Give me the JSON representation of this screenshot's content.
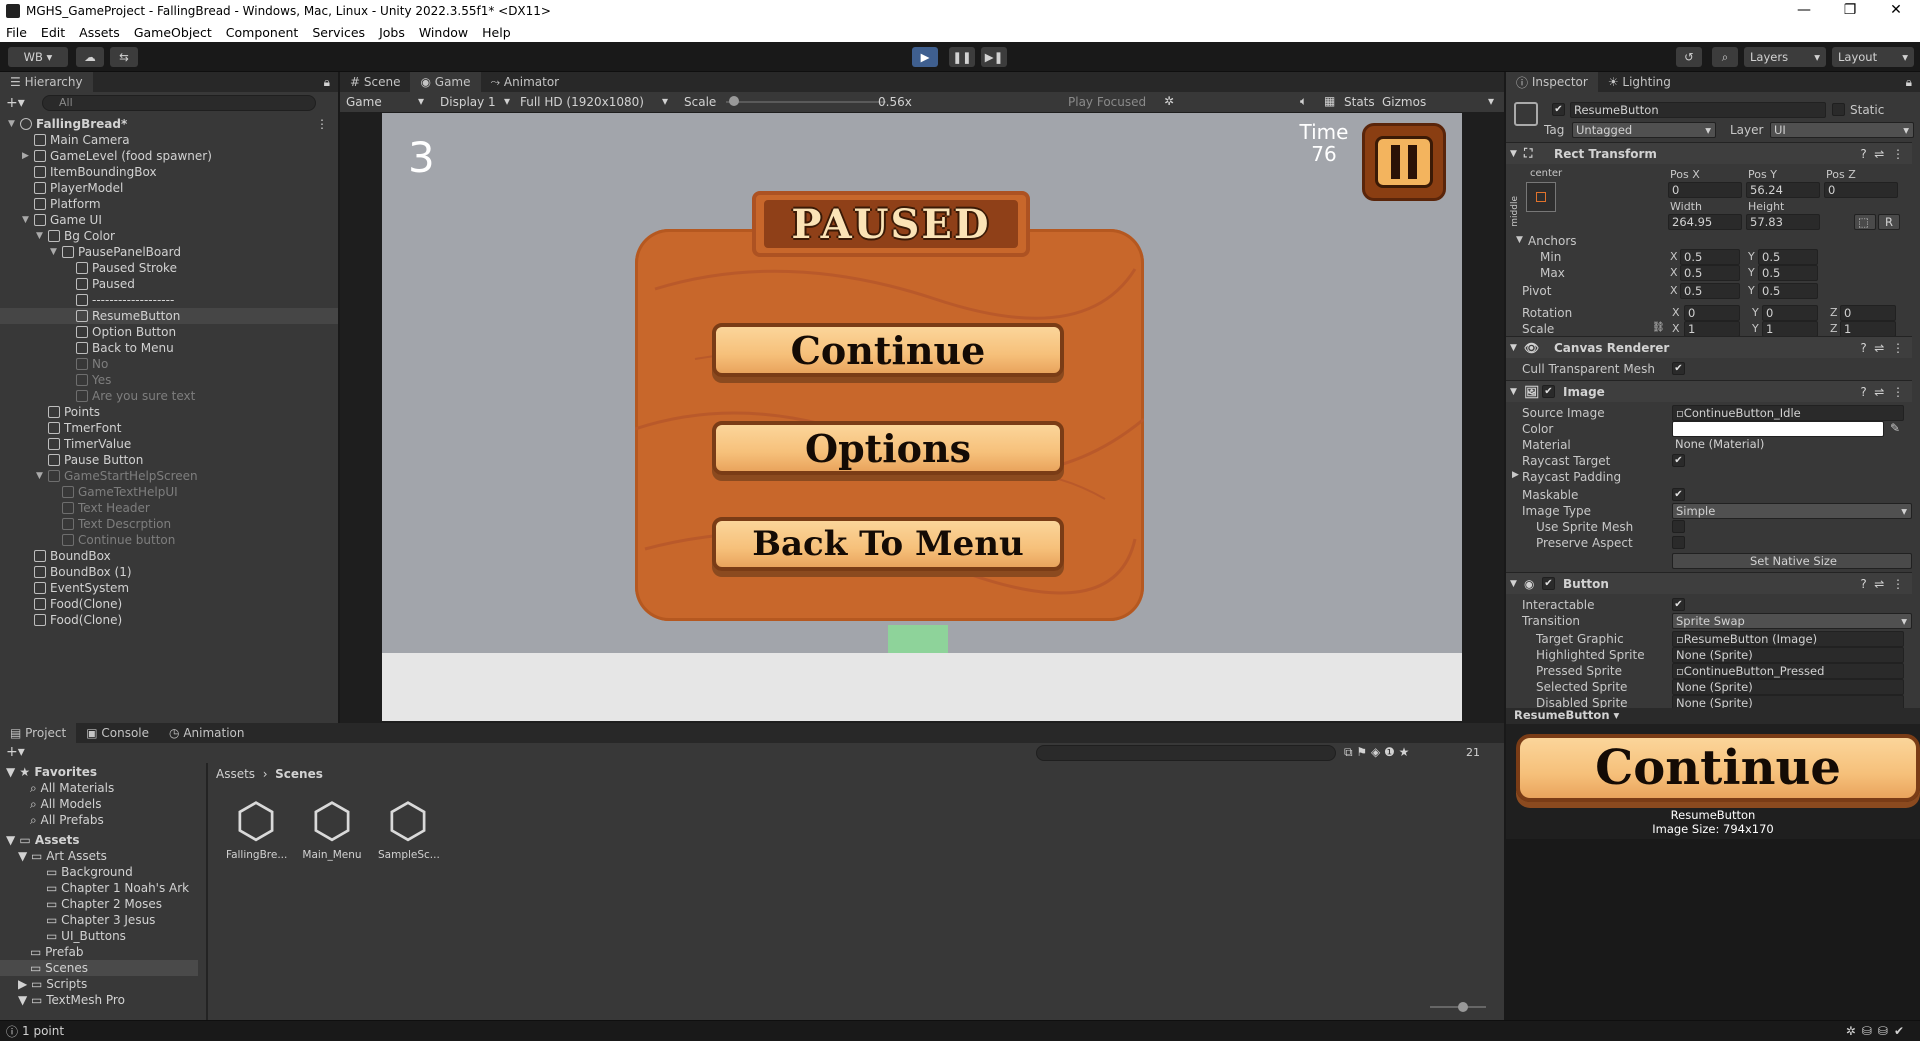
{
  "window": {
    "title": "MGHS_GameProject - FallingBread - Windows, Mac, Linux - Unity 2022.3.55f1* <DX11>"
  },
  "menu": [
    "File",
    "Edit",
    "Assets",
    "GameObject",
    "Component",
    "Services",
    "Jobs",
    "Window",
    "Help"
  ],
  "toolbar": {
    "account": "WB ▾",
    "layers": "Layers",
    "layout": "Layout"
  },
  "hierarchy": {
    "tab": "Hierarchy",
    "search_placeholder": "All",
    "rows": [
      {
        "label": "FallingBread*",
        "indent": 0,
        "arrow": "▼",
        "scene": true
      },
      {
        "label": "Main Camera",
        "indent": 1
      },
      {
        "label": "GameLevel (food spawner)",
        "indent": 1,
        "arrow": "▶"
      },
      {
        "label": "ItemBoundingBox",
        "indent": 1
      },
      {
        "label": "PlayerModel",
        "indent": 1
      },
      {
        "label": "Platform",
        "indent": 1
      },
      {
        "label": "Game UI",
        "indent": 1,
        "arrow": "▼"
      },
      {
        "label": "Bg Color",
        "indent": 2,
        "arrow": "▼"
      },
      {
        "label": "PausePanelBoard",
        "indent": 3,
        "arrow": "▼"
      },
      {
        "label": "Paused Stroke",
        "indent": 4
      },
      {
        "label": "Paused",
        "indent": 4
      },
      {
        "label": "-------------------",
        "indent": 4
      },
      {
        "label": "ResumeButton",
        "indent": 4,
        "selected": true
      },
      {
        "label": "Option Button",
        "indent": 4
      },
      {
        "label": "Back to Menu",
        "indent": 4
      },
      {
        "label": "No",
        "indent": 4,
        "dim": true
      },
      {
        "label": "Yes",
        "indent": 4,
        "dim": true
      },
      {
        "label": "Are you sure text",
        "indent": 4,
        "dim": true
      },
      {
        "label": "Points",
        "indent": 2
      },
      {
        "label": "TmerFont",
        "indent": 2
      },
      {
        "label": "TimerValue",
        "indent": 2
      },
      {
        "label": "Pause Button",
        "indent": 2
      },
      {
        "label": "GameStartHelpScreen",
        "indent": 2,
        "arrow": "▼",
        "dim": true
      },
      {
        "label": "GameTextHelpUI",
        "indent": 3,
        "dim": true
      },
      {
        "label": "Text Header",
        "indent": 3,
        "dim": true
      },
      {
        "label": "Text Descrption",
        "indent": 3,
        "dim": true
      },
      {
        "label": "Continue button",
        "indent": 3,
        "dim": true
      },
      {
        "label": "BoundBox",
        "indent": 1
      },
      {
        "label": "BoundBox (1)",
        "indent": 1
      },
      {
        "label": "EventSystem",
        "indent": 1
      },
      {
        "label": "Food(Clone)",
        "indent": 1
      },
      {
        "label": "Food(Clone)",
        "indent": 1
      }
    ]
  },
  "center_tabs": [
    "Scene",
    "Game",
    "Animator"
  ],
  "game_toolbar": {
    "game": "Game",
    "display": "Display 1",
    "resolution": "Full HD (1920x1080)",
    "scale_label": "Scale",
    "scale_value": "0.56x",
    "play_focused": "Play Focused",
    "stats": "Stats",
    "gizmos": "Gizmos",
    "scale_fraction": 0.02
  },
  "game_view": {
    "score": "3",
    "time_label": "Time",
    "time_value": "76",
    "paused_title": "PAUSED",
    "buttons": [
      "Continue",
      "Options",
      "Back To Menu"
    ]
  },
  "inspector": {
    "tabs": [
      "Inspector",
      "Lighting"
    ],
    "object_name": "ResumeButton",
    "static_label": "Static",
    "tag_label": "Tag",
    "tag_value": "Untagged",
    "layer_label": "Layer",
    "layer_value": "UI",
    "rect_transform": {
      "title": "Rect Transform",
      "anchor_preset": "center",
      "anchor_side": "middle",
      "pos_x_label": "Pos X",
      "pos_x": "0",
      "pos_y_label": "Pos Y",
      "pos_y": "56.24",
      "pos_z_label": "Pos Z",
      "pos_z": "0",
      "width_label": "Width",
      "width": "264.95",
      "height_label": "Height",
      "height": "57.83",
      "r_button": "R",
      "anchors_label": "Anchors",
      "min_label": "Min",
      "min_x": "0.5",
      "min_y": "0.5",
      "max_label": "Max",
      "max_x": "0.5",
      "max_y": "0.5",
      "pivot_label": "Pivot",
      "pivot_x": "0.5",
      "pivot_y": "0.5",
      "rotation_label": "Rotation",
      "rot_x": "0",
      "rot_y": "0",
      "rot_z": "0",
      "scale_label": "Scale",
      "scale_x": "1",
      "scale_y": "1",
      "scale_z": "1",
      "x": "X",
      "y": "Y",
      "z": "Z"
    },
    "canvas_renderer": {
      "title": "Canvas Renderer",
      "cull": "Cull Transparent Mesh"
    },
    "image": {
      "title": "Image",
      "source_image_label": "Source Image",
      "source_image": "ContinueButton_Idle",
      "color_label": "Color",
      "color_value": "#ffffff",
      "material_label": "Material",
      "material": "None (Material)",
      "raycast_target": "Raycast Target",
      "raycast_padding": "Raycast Padding",
      "maskable": "Maskable",
      "image_type_label": "Image Type",
      "image_type": "Simple",
      "use_sprite_mesh": "Use Sprite Mesh",
      "preserve_aspect": "Preserve Aspect",
      "set_native_size": "Set Native Size"
    },
    "button": {
      "title": "Button",
      "interactable": "Interactable",
      "transition_label": "Transition",
      "transition": "Sprite Swap",
      "target_graphic_label": "Target Graphic",
      "target_graphic": "ResumeButton (Image)",
      "highlighted_label": "Highlighted Sprite",
      "highlighted": "None (Sprite)",
      "pressed_label": "Pressed Sprite",
      "pressed": "ContinueButton_Pressed",
      "selected_label": "Selected Sprite",
      "selected": "None (Sprite)",
      "disabled_label": "Disabled Sprite",
      "disabled": "None (Sprite)"
    },
    "preview": {
      "dropdown": "ResumeButton ▾",
      "text": "Continue",
      "name": "ResumeButton",
      "size": "Image Size: 794x170"
    }
  },
  "bottom": {
    "tabs": [
      "Project",
      "Console",
      "Animation"
    ],
    "hidden_count": "21",
    "favorites": {
      "label": "Favorites",
      "items": [
        "All Materials",
        "All Models",
        "All Prefabs"
      ]
    },
    "assets": {
      "label": "Assets",
      "art_assets": "Art Assets",
      "art_children": [
        "Background",
        "Chapter 1 Noah's Ark",
        "Chapter 2 Moses",
        "Chapter 3 Jesus",
        "UI_Buttons"
      ],
      "others": [
        "Prefab",
        "Scenes",
        "Scripts",
        "TextMesh Pro"
      ]
    },
    "breadcrumb": [
      "Assets",
      "Scenes"
    ],
    "scenes": [
      "FallingBre...",
      "Main_Menu",
      "SampleSc..."
    ]
  },
  "status": {
    "text": "1 point"
  },
  "colors": {
    "accent": "#4d7fc9",
    "board": "#c8672b",
    "game_bg": "#a2a5ab",
    "ground": "#e6e6e6",
    "platform": "#8ed39a"
  }
}
